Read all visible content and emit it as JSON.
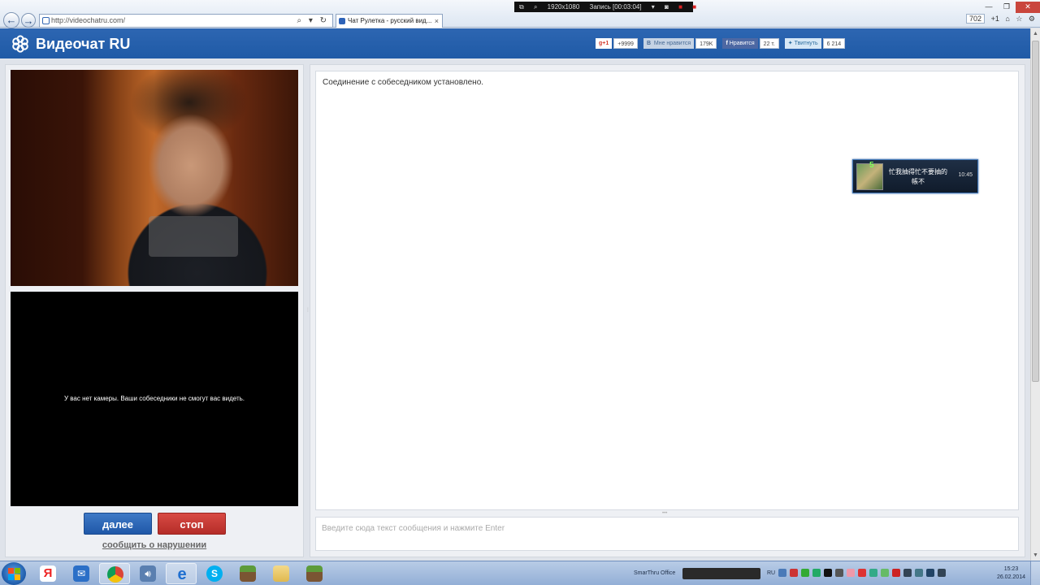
{
  "browser": {
    "url": "http://videochatru.com/",
    "tab_title": "Чат Рулетка - русский вид...",
    "tab_close": "×",
    "notifications_count": "702",
    "plus_one": "+1",
    "back_symbol": "←",
    "forward_symbol": "→",
    "address_tools": "⌕ ▾ ↻",
    "window_controls": [
      "—",
      "❐",
      "✕"
    ]
  },
  "recorder": {
    "resolution": "1920x1080",
    "status": "Запись [00:03:04]"
  },
  "site": {
    "logo_text": "Видеочат RU",
    "social": {
      "gplus_label": "g+1",
      "gplus_count": "+9999",
      "vk_label": "Мне нравится",
      "vk_count": "179K",
      "fb_label": "Нравится",
      "fb_count": "22 т.",
      "tw_label": "Твитнуть",
      "tw_count": "6 214"
    }
  },
  "video": {
    "no_camera_message": "У вас нет камеры. Ваши собеседники не смогут вас видеть."
  },
  "controls": {
    "next_label": "далее",
    "stop_label": "стоп",
    "report_label": "сообщить о нарушении"
  },
  "chat": {
    "system_message": "Соединение с собеседником установлено.",
    "input_placeholder": "Введите сюда текст сообщения и нажмите Enter"
  },
  "popup": {
    "number": "5",
    "text": "忙我抽得忙不要抽的帳不",
    "time": "10:45"
  },
  "taskbar": {
    "apps": [
      "windows-explorer",
      "yandex-browser",
      "mail",
      "chrome",
      "audio-player",
      "internet-explorer",
      "skype",
      "minecraft",
      "folder",
      "minecraft"
    ],
    "tray_label": "SmarThru Office",
    "language": "RU",
    "time": "15:23",
    "date": "26.02.2014"
  },
  "colors": {
    "header_blue": "#2360ab",
    "next_button": "#2d68b8",
    "stop_button": "#c43a35"
  }
}
